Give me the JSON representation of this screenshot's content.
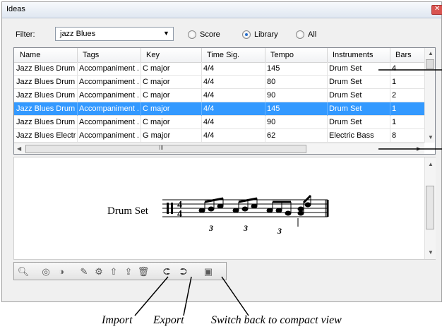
{
  "window": {
    "title": "Ideas"
  },
  "filter": {
    "label": "Filter:",
    "value": "jazz Blues",
    "scope_options": [
      {
        "label": "Score",
        "checked": false
      },
      {
        "label": "Library",
        "checked": true
      },
      {
        "label": "All",
        "checked": false
      }
    ]
  },
  "table": {
    "columns": [
      "Name",
      "Tags",
      "Key",
      "Time Sig.",
      "Tempo",
      "Instruments",
      "Bars"
    ],
    "rows": [
      {
        "cells": [
          "Jazz Blues Drum ...",
          "Accompaniment ...",
          "C major",
          "4/4",
          "145",
          "Drum Set",
          "4"
        ],
        "selected": false
      },
      {
        "cells": [
          "Jazz Blues Drum ...",
          "Accompaniment ...",
          "C major",
          "4/4",
          "80",
          "Drum Set",
          "1"
        ],
        "selected": false
      },
      {
        "cells": [
          "Jazz Blues Drum ...",
          "Accompaniment ...",
          "C major",
          "4/4",
          "90",
          "Drum Set",
          "2"
        ],
        "selected": false
      },
      {
        "cells": [
          "Jazz Blues Drum ...",
          "Accompaniment ...",
          "C major",
          "4/4",
          "145",
          "Drum Set",
          "1"
        ],
        "selected": true
      },
      {
        "cells": [
          "Jazz Blues Drum ...",
          "Accompaniment ...",
          "C major",
          "4/4",
          "90",
          "Drum Set",
          "1"
        ],
        "selected": false
      },
      {
        "cells": [
          "Jazz Blues Electri...",
          "Accompaniment ...",
          "G major",
          "4/4",
          "62",
          "Electric Bass",
          "8"
        ],
        "selected": false
      }
    ],
    "hscroll_grip": "III"
  },
  "preview": {
    "instrument": "Drum Set",
    "time_signature": "4/4",
    "tuplet_number": "3"
  },
  "toolbar": {
    "icons": [
      "magnify-icon",
      "new-idea-icon",
      "duplicate-idea-icon",
      "edit-idea-icon",
      "idea-properties-icon",
      "paste-to-score-icon",
      "capture-icon",
      "delete-icon",
      "import-icon",
      "export-icon",
      "compact-view-icon"
    ]
  },
  "callouts": {
    "import": "Import",
    "export": "Export",
    "compact": "Switch back to compact view"
  },
  "colors": {
    "selection": "#3399ff",
    "window_bg": "#f0f0f0"
  }
}
